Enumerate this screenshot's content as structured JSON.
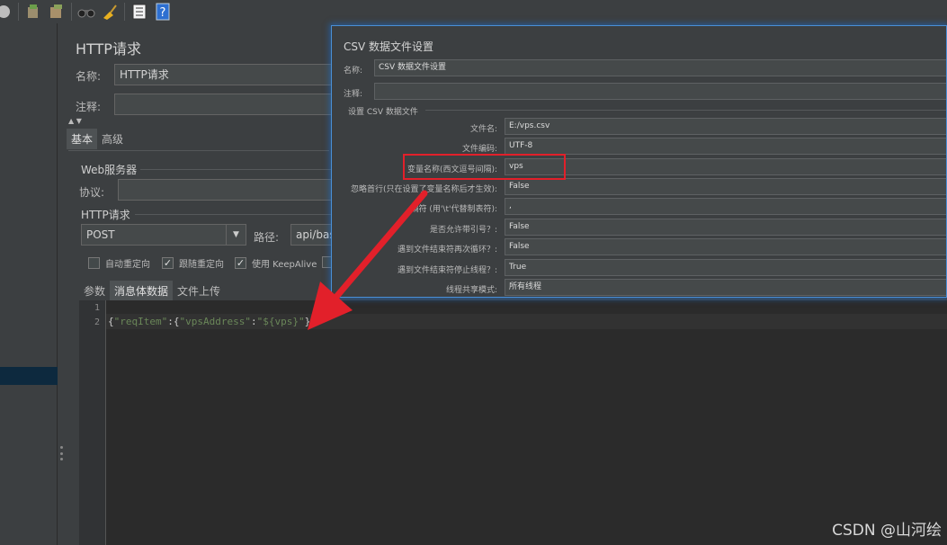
{
  "http_request": {
    "title": "HTTP请求",
    "name_label": "名称:",
    "name_value": "HTTP请求",
    "comment_label": "注释:",
    "tabs": [
      "基本",
      "高级"
    ],
    "web_server_section": "Web服务器",
    "protocol_label": "协议:",
    "http_section": "HTTP请求",
    "method": "POST",
    "path_label": "路径:",
    "path_value": "api/bas",
    "checkboxes": [
      {
        "label": "自动重定向",
        "checked": false
      },
      {
        "label": "跟随重定向",
        "checked": true
      },
      {
        "label": "使用 KeepAlive",
        "checked": true
      }
    ],
    "body_tabs": [
      "参数",
      "消息体数据",
      "文件上传"
    ],
    "editor": {
      "line_numbers": [
        "1",
        "2"
      ],
      "code_parts": [
        "{",
        "\"reqItem\"",
        ":{",
        "\"vpsAddress\"",
        ":",
        "\"${vps}\"",
        "}}"
      ]
    }
  },
  "csv_config": {
    "title": "CSV 数据文件设置",
    "name_label": "名称:",
    "name_value": "CSV 数据文件设置",
    "comment_label": "注释:",
    "section": "设置 CSV 数据文件",
    "rows": [
      {
        "label": "文件名:",
        "value": "E:/vps.csv"
      },
      {
        "label": "文件编码:",
        "value": "UTF-8"
      },
      {
        "label": "变量名称(西文逗号间隔):",
        "value": "vps"
      },
      {
        "label": "忽略首行(只在设置了变量名称后才生效):",
        "value": "False"
      },
      {
        "label": "隔符 (用'\\t'代替制表符):",
        "value": ","
      },
      {
        "label": "是否允许带引号？:",
        "value": "False"
      },
      {
        "label": "遇到文件结束符再次循环？:",
        "value": "False"
      },
      {
        "label": "遇到文件结束符停止线程？:",
        "value": "True"
      },
      {
        "label": "线程共享模式:",
        "value": "所有线程"
      }
    ]
  },
  "watermark": "CSDN @山河绘",
  "colors": {
    "highlight_box": "#e2202a",
    "arrow": "#e2202a",
    "overlay_border": "#4a8fd6"
  }
}
